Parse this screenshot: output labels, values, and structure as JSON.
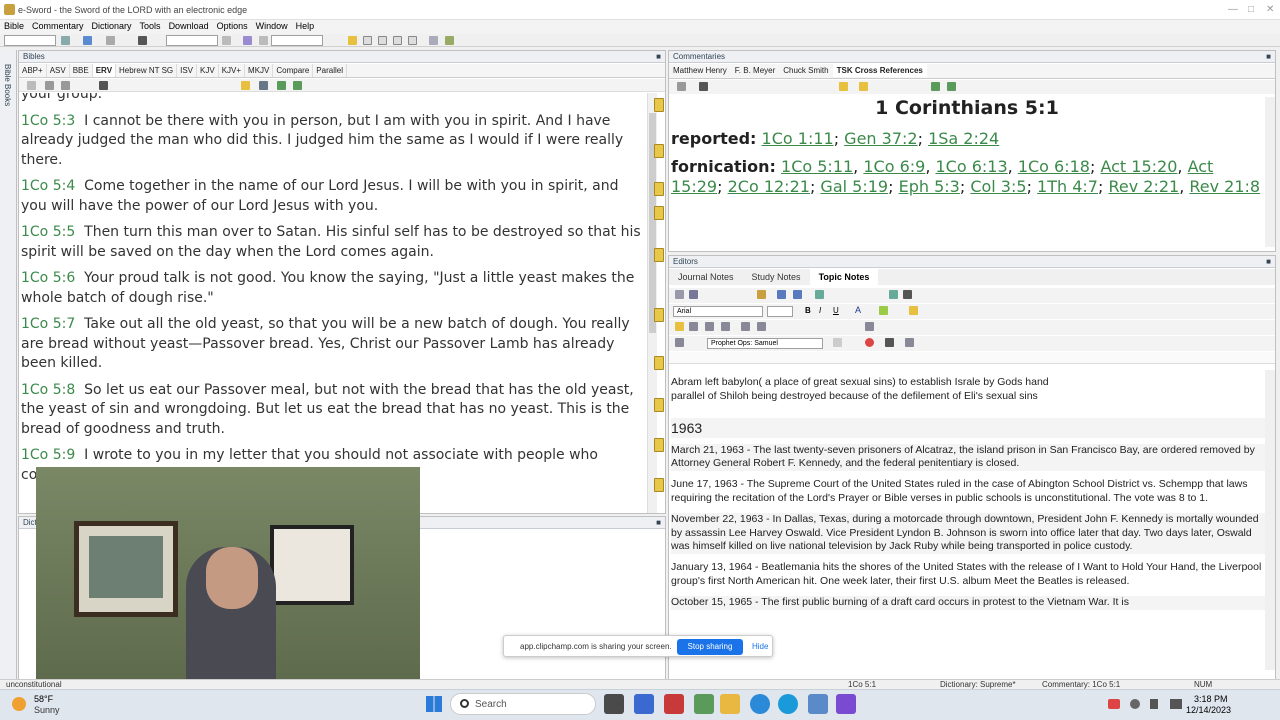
{
  "window": {
    "title": "e-Sword - the Sword of the LORD with an electronic edge"
  },
  "menu": [
    "Bible",
    "Commentary",
    "Dictionary",
    "Tools",
    "Download",
    "Options",
    "Window",
    "Help"
  ],
  "bibles": {
    "header": "Bibles",
    "sidetab": "Bible Books",
    "tabs": [
      "ABP+",
      "ASV",
      "BBE",
      "ERV",
      "Hebrew NT SG",
      "ISV",
      "KJV",
      "KJV+",
      "MKJV",
      "Compare",
      "Parallel"
    ],
    "active_tab": "ERV",
    "partial_top": "your group.",
    "verses": [
      {
        "ref": "1Co 5:3",
        "text": "I cannot be there with you in person, but I am with you in spirit. And I have already judged the man who did this. I judged him the same as I would if I were really there."
      },
      {
        "ref": "1Co 5:4",
        "text": "Come together in the name of our Lord Jesus. I will be with you in spirit, and you will have the power of our Lord Jesus with you."
      },
      {
        "ref": "1Co 5:5",
        "text": "Then turn this man over to Satan. His sinful self has to be destroyed so that his spirit will be saved on the day when the Lord comes again."
      },
      {
        "ref": "1Co 5:6",
        "text": "Your proud talk is not good. You know the saying, \"Just a little yeast makes the whole batch of dough rise.\""
      },
      {
        "ref": "1Co 5:7",
        "text": "Take out all the old yeast, so that you will be a new batch of dough. You really are bread without yeast—Passover bread. Yes, Christ our Passover Lamb has already been killed."
      },
      {
        "ref": "1Co 5:8",
        "text": "So let us eat our Passover meal, but not with the bread that has the old yeast, the yeast of sin and wrongdoing. But let us eat the bread that has no yeast. This is the bread of goodness and truth."
      },
      {
        "ref": "1Co 5:9",
        "text": "I wrote to you in my letter that you should not associate with people who commit sexual sin."
      }
    ]
  },
  "dictionary": {
    "header": "Dictionary"
  },
  "commentaries": {
    "header": "Commentaries",
    "tabs": [
      "Matthew Henry",
      "F. B. Meyer",
      "Chuck Smith",
      "TSK Cross References"
    ],
    "active_tab": "TSK Cross References",
    "heading": "1 Corinthians 5:1",
    "rows": [
      {
        "label": "reported:",
        "links": [
          "1Co 1:11",
          "Gen 37:2",
          "1Sa 2:24"
        ]
      },
      {
        "label": "fornication:",
        "links": [
          "1Co 5:11",
          "1Co 6:9",
          "1Co 6:13",
          "1Co 6:18",
          "Act 15:20",
          "Act 15:29",
          "2Co 12:21",
          "Gal 5:19",
          "Eph 5:3",
          "Col 3:5",
          "1Th 4:7",
          "Rev 2:21",
          "Rev 21:8"
        ]
      }
    ]
  },
  "editors": {
    "header": "Editors",
    "tabs": [
      "Journal Notes",
      "Study Notes",
      "Topic Notes"
    ],
    "active_tab": "Topic Notes",
    "font": "Arial",
    "topic": "Prophet Ops: Samuel",
    "lines_top": [
      "Abram left babylon( a place of great sexual sins) to establish Israle by Gods hand",
      "parallel of Shiloh being destroyed because of the defilement of Eli's sexual sins"
    ],
    "year": "1963",
    "entries": [
      "March 21, 1963 - The last twenty-seven prisoners of Alcatraz, the island prison in San Francisco Bay, are ordered removed by Attorney General Robert F. Kennedy, and the federal penitentiary is closed.",
      "June 17, 1963 - The Supreme Court of the United States ruled in the case of Abington School District vs. Schempp that laws requiring the recitation of the Lord's Prayer or Bible verses in public schools is unconstitutional. The vote was 8 to 1.",
      "November 22, 1963 - In Dallas, Texas, during a motorcade through downtown, President John F. Kennedy is mortally wounded by assassin Lee Harvey Oswald. Vice President Lyndon B. Johnson is sworn into office later that day. Two days later, Oswald was himself killed on live national television by Jack Ruby while being transported in police custody.",
      "January 13, 1964 - Beatlemania hits the shores of the United States with the release of I Want to Hold Your Hand, the Liverpool group's first North American hit. One week later, their first U.S. album Meet the Beatles is released.",
      "October 15, 1965 - The first public burning of a draft card occurs in protest to the Vietnam War. It is"
    ]
  },
  "share_bar": {
    "message": "app.clipchamp.com is sharing your screen.",
    "stop": "Stop sharing",
    "hide": "Hide"
  },
  "status": {
    "left": "unconstitutional",
    "ref": "1Co 5:1",
    "dict": "Dictionary: Supreme*",
    "comm": "Commentary: 1Co 5:1",
    "num": "NUM"
  },
  "taskbar": {
    "weather_temp": "58°F",
    "weather_cond": "Sunny",
    "search": "Search",
    "time": "3:18 PM",
    "date": "12/14/2023"
  }
}
